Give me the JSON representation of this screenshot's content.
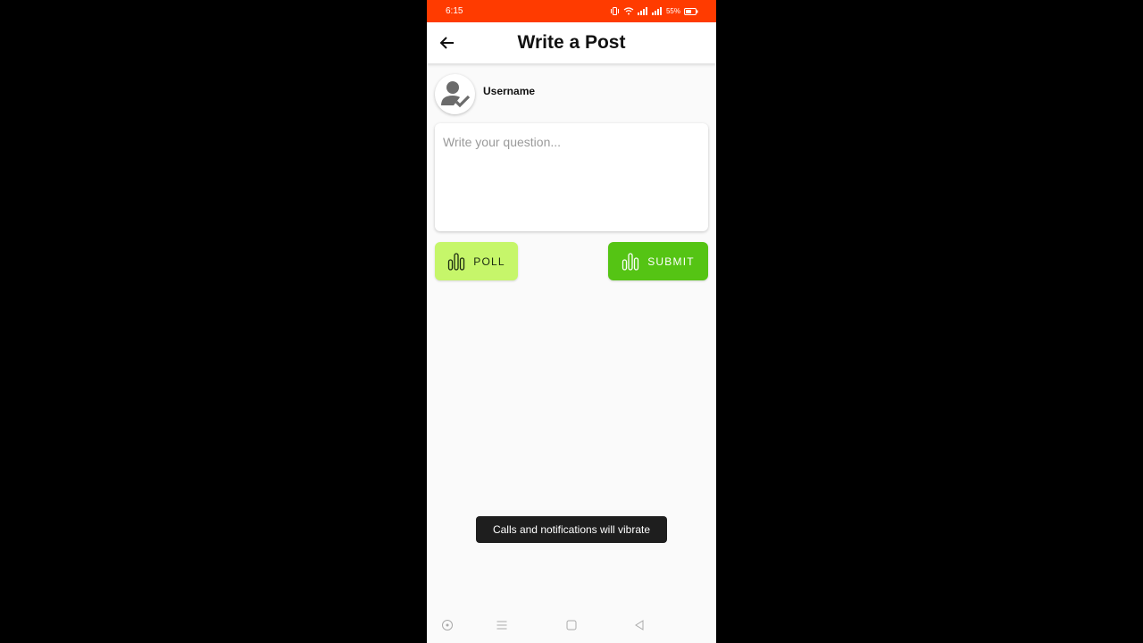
{
  "status_bar": {
    "time": "6:15",
    "battery": "55%",
    "color": "#ff3b00",
    "icons": [
      "vibrate-icon",
      "wifi-icon",
      "signal-icon",
      "signal-icon",
      "battery-icon"
    ]
  },
  "app_bar": {
    "title": "Write a Post",
    "back_icon": "arrow-left-icon"
  },
  "user": {
    "name": "Username",
    "avatar_icon": "user-check-icon"
  },
  "question": {
    "placeholder": "Write your question...",
    "value": ""
  },
  "actions": {
    "poll_label": "POLL",
    "poll_color": "#c6f66a",
    "poll_icon": "bar-chart-icon",
    "submit_label": "SUBMIT",
    "submit_color": "#55c414",
    "submit_icon": "bar-chart-icon"
  },
  "toast": {
    "message": "Calls and notifications will vibrate"
  },
  "nav_bar": {
    "icons": [
      "accessibility-icon",
      "menu-icon",
      "home-square-icon",
      "back-triangle-icon"
    ]
  }
}
